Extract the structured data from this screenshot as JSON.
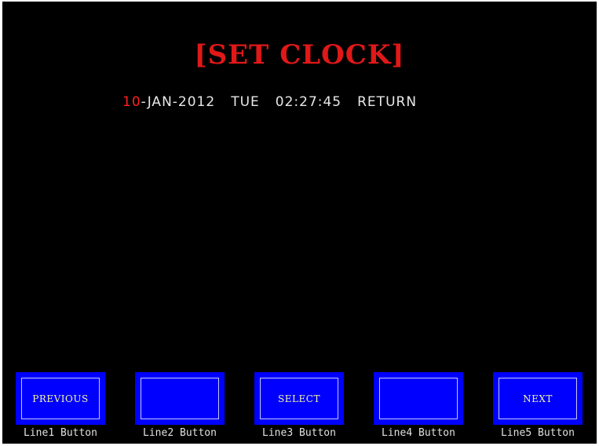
{
  "screen": {
    "title": "[SET CLOCK]",
    "clock": {
      "day": "10",
      "month_year": "-JAN-2012",
      "weekday": "TUE",
      "time": "02:27:45",
      "return_label": "RETURN"
    }
  },
  "softkeys": [
    {
      "label": "PREVIOUS",
      "caption": "Line1 Button"
    },
    {
      "label": "",
      "caption": "Line2 Button"
    },
    {
      "label": "SELECT",
      "caption": "Line3 Button"
    },
    {
      "label": "",
      "caption": "Line4 Button"
    },
    {
      "label": "NEXT",
      "caption": "Line5 Button"
    }
  ],
  "colors": {
    "background": "#000000",
    "title": "#e01818",
    "selected_field": "#ff2020",
    "text": "#e8e8e8",
    "softkey_fill": "#0000ff",
    "softkey_label": "#f5f5a0"
  }
}
